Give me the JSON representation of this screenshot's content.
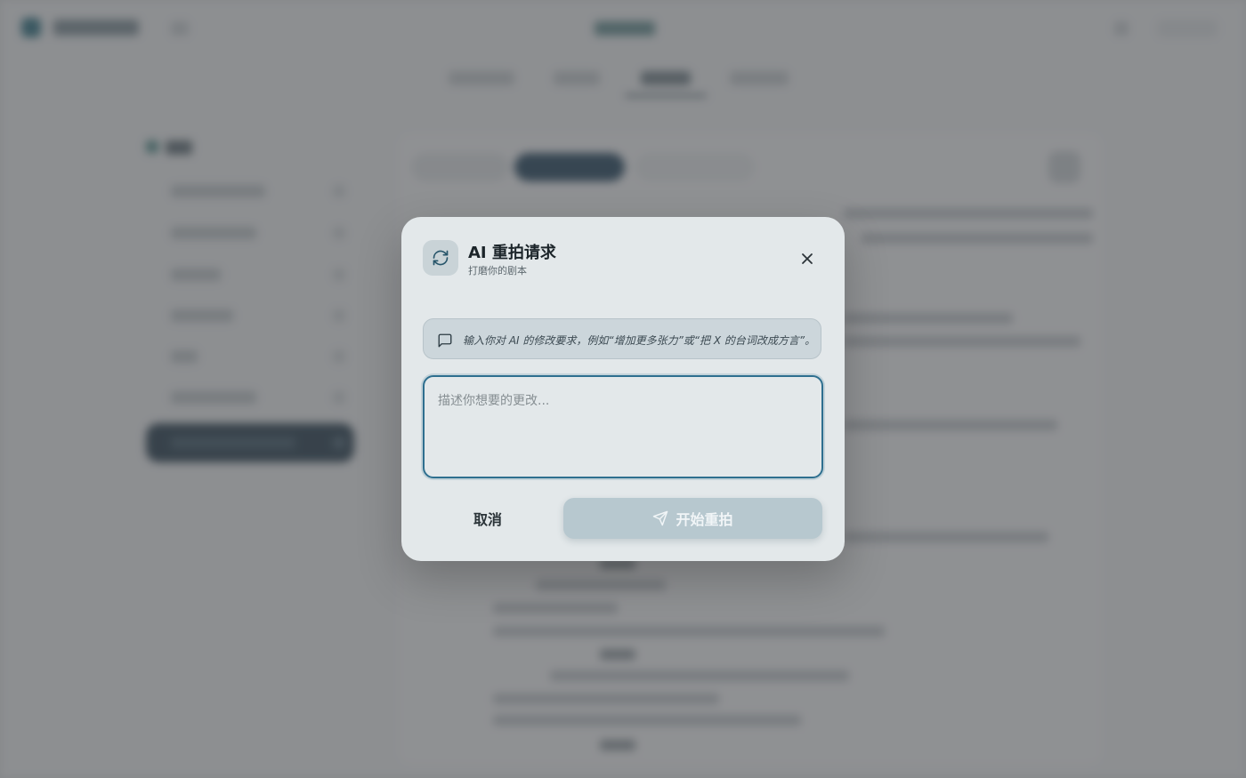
{
  "modal": {
    "title": "AI 重拍请求",
    "subtitle": "打磨你的剧本",
    "icon": "refresh-icon",
    "close_icon": "close-icon",
    "hint": {
      "icon": "message-square-icon",
      "text": "输入你对 AI 的修改要求，例如“增加更多张力”或“把 X 的台词改成方言”。"
    },
    "input": {
      "value": "",
      "placeholder": "描述你想要的更改..."
    },
    "cancel_label": "取消",
    "submit": {
      "label": "开始重拍",
      "icon": "send-icon"
    }
  },
  "colors": {
    "accent": "#2e6f8f",
    "submit_disabled": "#b7c8cf",
    "modal_bg": "#e3e8ea"
  }
}
